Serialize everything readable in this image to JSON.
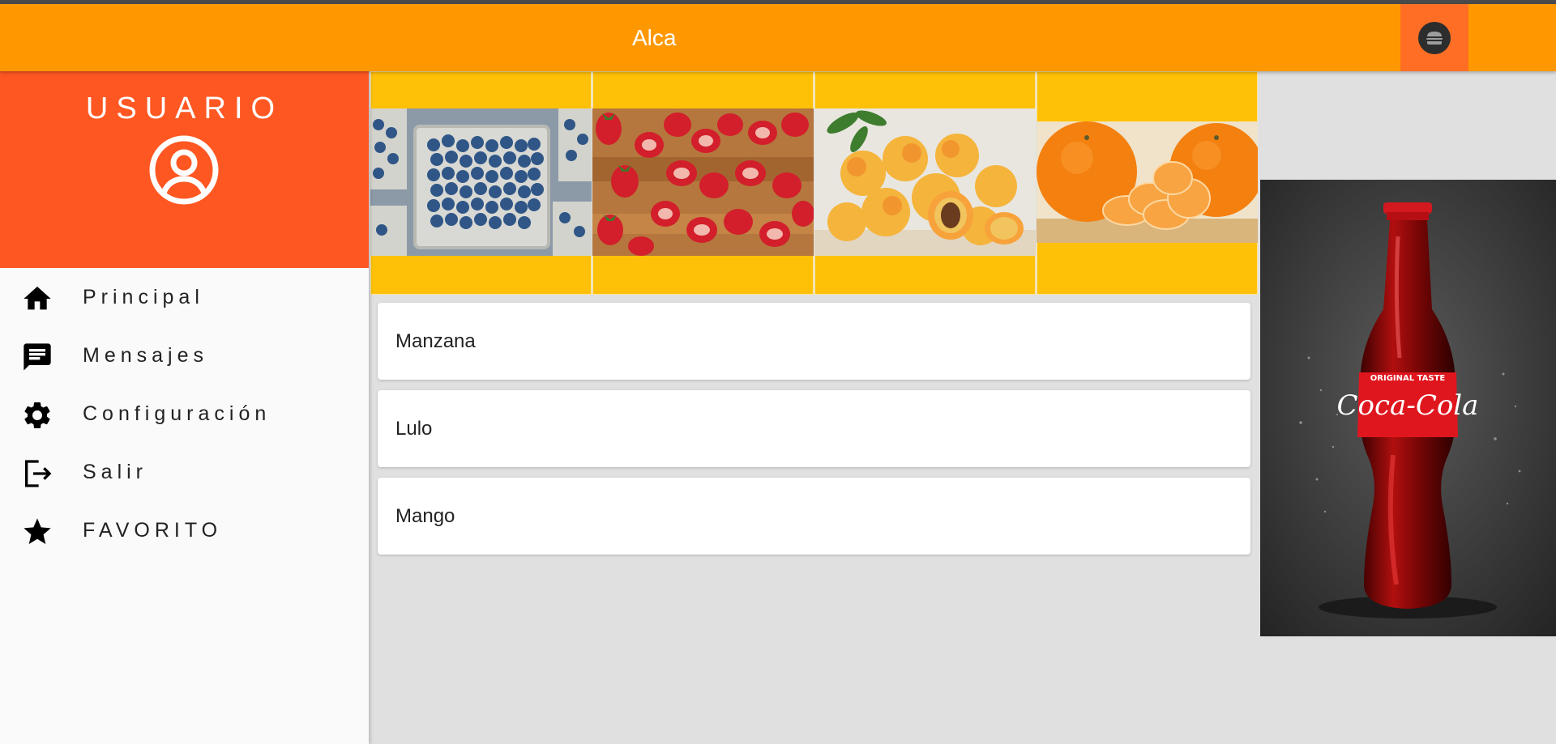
{
  "appbar": {
    "title": "Alca",
    "action_icon": "burger-icon",
    "color": "#ff9800",
    "action_color": "#ff6e24"
  },
  "drawer": {
    "header_label": "USUARIO",
    "header_icon": "account-circle-icon",
    "header_color": "#ff5722",
    "items": [
      {
        "label": "Principal",
        "icon": "home-icon"
      },
      {
        "label": "Mensajes",
        "icon": "message-icon"
      },
      {
        "label": "Configuración",
        "icon": "gear-icon"
      },
      {
        "label": "Salir",
        "icon": "logout-icon"
      },
      {
        "label": "FAVORITO",
        "icon": "star-icon"
      }
    ]
  },
  "gallery": {
    "tile_color": "#ffc107",
    "images": [
      "blueberries-photo",
      "strawberries-photo",
      "apricots-photo",
      "mandarins-photo"
    ]
  },
  "list": {
    "items": [
      "Manzana",
      "Lulo",
      "Mango"
    ]
  },
  "side_image": {
    "image": "coca-cola-bottle-photo",
    "label_top": "ORIGINAL TASTE",
    "brand": "Coca-Cola"
  }
}
